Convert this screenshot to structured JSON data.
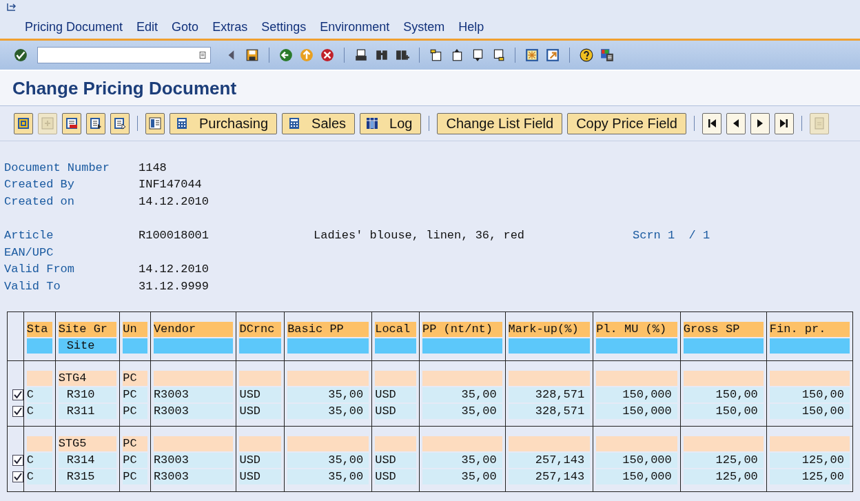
{
  "menu_bar": {
    "items": [
      "Pricing Document",
      "Edit",
      "Goto",
      "Extras",
      "Settings",
      "Environment",
      "System",
      "Help"
    ]
  },
  "title": "Change Pricing Document",
  "app_toolbar": {
    "groups": [
      [
        {
          "kind": "icon",
          "disabled": false
        },
        {
          "kind": "icon",
          "disabled": true
        },
        {
          "kind": "icon",
          "disabled": false
        },
        {
          "kind": "icon",
          "disabled": false
        },
        {
          "kind": "icon",
          "disabled": false
        }
      ],
      [
        {
          "kind": "icon",
          "disabled": false
        },
        {
          "kind": "icon_text",
          "label": "Purchasing",
          "disabled": false
        },
        {
          "kind": "icon_text",
          "label": "Sales",
          "disabled": false
        },
        {
          "kind": "icon_text",
          "label": "Log",
          "disabled": false
        }
      ],
      [
        {
          "kind": "text",
          "label": "Change List Field",
          "disabled": false
        },
        {
          "kind": "text",
          "label": "Copy Price Field",
          "disabled": false
        }
      ],
      [
        {
          "kind": "icon",
          "disabled": false
        },
        {
          "kind": "icon",
          "disabled": false
        },
        {
          "kind": "icon",
          "disabled": false
        },
        {
          "kind": "icon",
          "disabled": false
        }
      ],
      [
        {
          "kind": "icon",
          "disabled": true
        }
      ]
    ]
  },
  "header_fields": [
    {
      "label": "Document Number",
      "value": "1148"
    },
    {
      "label": "Created By",
      "value": "INF147044"
    },
    {
      "label": "Created on",
      "value": "14.12.2010"
    }
  ],
  "article_fields": [
    {
      "label": "Article",
      "value": "R100018001",
      "description": "Ladies' blouse, linen, 36, red",
      "screen": "Scrn 1  / 1"
    },
    {
      "label": "EAN/UPC"
    },
    {
      "label": "Valid From",
      "value": "14.12.2010"
    },
    {
      "label": "Valid To",
      "value": "31.12.9999"
    }
  ],
  "table": {
    "columns": [
      {
        "label": "Sta",
        "kind": "text"
      },
      {
        "label": "Site Gr",
        "sublabel": "Site",
        "kind": "site"
      },
      {
        "label": "Un",
        "kind": "text"
      },
      {
        "label": "Vendor",
        "kind": "text"
      },
      {
        "label": "DCrnc",
        "kind": "text"
      },
      {
        "label": "Basic PP",
        "kind": "amount"
      },
      {
        "label": "Local",
        "kind": "text"
      },
      {
        "label": "PP (nt/nt)",
        "kind": "amount"
      },
      {
        "label": "Mark-up(%)",
        "kind": "amount"
      },
      {
        "label": "Pl. MU (%)",
        "kind": "amount"
      },
      {
        "label": "Gross SP",
        "kind": "amount"
      },
      {
        "label": "Fin. pr.",
        "kind": "amount"
      }
    ],
    "groups": [
      {
        "site_group": "STG4",
        "unit": "PC",
        "rows": [
          {
            "checked": true,
            "cells": [
              "C",
              "R310",
              "PC",
              "R3003",
              "USD",
              "35,00",
              "USD",
              "35,00",
              "328,571",
              "150,000",
              "150,00",
              "150,00"
            ]
          },
          {
            "checked": true,
            "cells": [
              "C",
              "R311",
              "PC",
              "R3003",
              "USD",
              "35,00",
              "USD",
              "35,00",
              "328,571",
              "150,000",
              "150,00",
              "150,00"
            ]
          }
        ]
      },
      {
        "site_group": "STG5",
        "unit": "PC",
        "rows": [
          {
            "checked": true,
            "cells": [
              "C",
              "R314",
              "PC",
              "R3003",
              "USD",
              "35,00",
              "USD",
              "35,00",
              "257,143",
              "150,000",
              "125,00",
              "125,00"
            ]
          },
          {
            "checked": true,
            "cells": [
              "C",
              "R315",
              "PC",
              "R3003",
              "USD",
              "35,00",
              "USD",
              "35,00",
              "257,143",
              "150,000",
              "125,00",
              "125,00"
            ]
          }
        ]
      }
    ]
  }
}
